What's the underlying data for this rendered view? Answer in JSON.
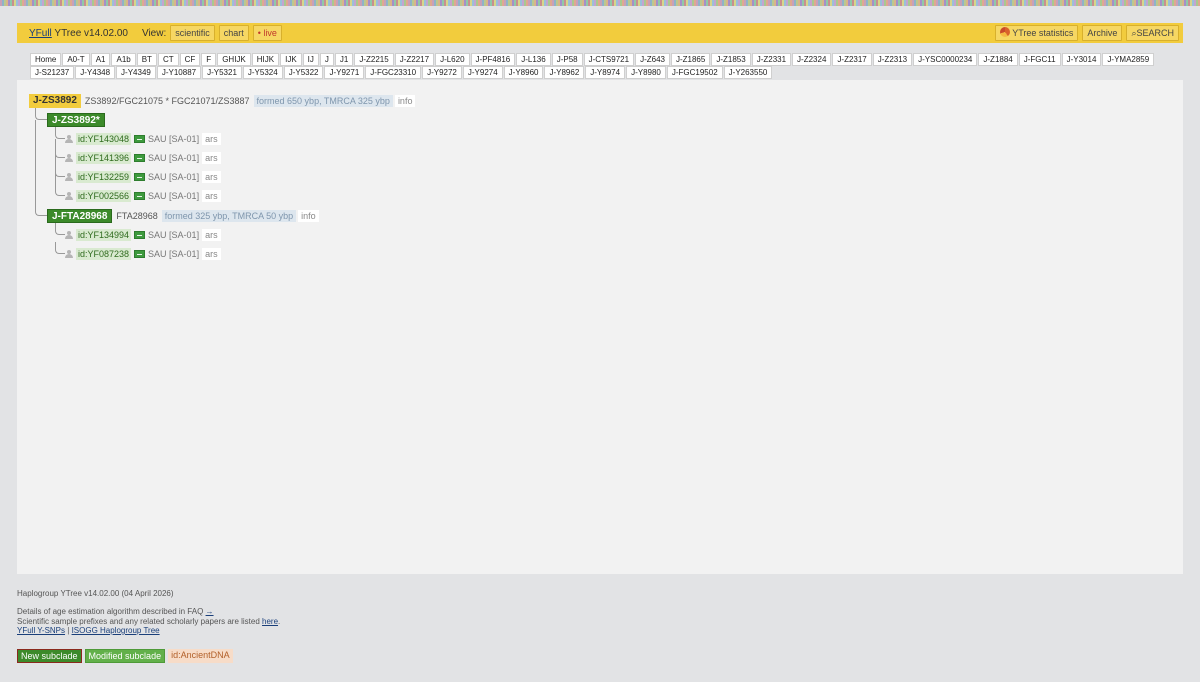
{
  "header": {
    "brand_link": "YFull",
    "brand_rest": " YTree v14.02.00",
    "view_label": "View:",
    "view_buttons": [
      "scientific",
      "chart",
      "• live"
    ],
    "stats_label": "YTree statistics",
    "archive_label": "Archive",
    "search_label": "⌕SEARCH"
  },
  "tabs": [
    "Home",
    "A0-T",
    "A1",
    "A1b",
    "BT",
    "CT",
    "CF",
    "F",
    "GHIJK",
    "HIJK",
    "IJK",
    "IJ",
    "J",
    "J1",
    "J-Z2215",
    "J-Z2217",
    "J-L620",
    "J-PF4816",
    "J-L136",
    "J-P58",
    "J-CTS9721",
    "J-Z643",
    "J-Z1865",
    "J-Z1853",
    "J-Z2331",
    "J-Z2324",
    "J-Z2317",
    "J-Z2313",
    "J-YSC0000234",
    "J-Z1884",
    "J-FGC11",
    "J-Y3014",
    "J-YMA2859",
    "J-S21237",
    "J-Y4348",
    "J-Y4349",
    "J-Y10887",
    "J-Y5321",
    "J-Y5324",
    "J-Y5322",
    "J-Y9271",
    "J-FGC23310",
    "J-Y9272",
    "J-Y9274",
    "J-Y8960",
    "J-Y8962",
    "J-Y8974",
    "J-Y8980",
    "J-FGC19502",
    "J-Y263550"
  ],
  "tree": {
    "root": {
      "name": "J-ZS3892",
      "snps": "ZS3892/FGC21075 * FGC21071/ZS3887",
      "formed": "formed 650 ybp, TMRCA 325 ybp",
      "info": "info"
    },
    "sub1": {
      "name": "J-ZS3892*",
      "samples": [
        {
          "id": "id:YF143048",
          "place": "SAU [SA-01]",
          "tag": "ars"
        },
        {
          "id": "id:YF141396",
          "place": "SAU [SA-01]",
          "tag": "ars"
        },
        {
          "id": "id:YF132259",
          "place": "SAU [SA-01]",
          "tag": "ars"
        },
        {
          "id": "id:YF002566",
          "place": "SAU [SA-01]",
          "tag": "ars"
        }
      ]
    },
    "sub2": {
      "name": "J-FTA28968",
      "snps": "FTA28968",
      "formed": "formed 325 ybp, TMRCA 50 ybp",
      "info": "info",
      "samples": [
        {
          "id": "id:YF134994",
          "place": "SAU [SA-01]",
          "tag": "ars"
        },
        {
          "id": "id:YF087238",
          "place": "SAU [SA-01]",
          "tag": "ars"
        }
      ]
    }
  },
  "footer": {
    "version_line": "Haplogroup YTree v14.02.00 (04 April 2026)",
    "faq_text": "Details of age estimation algorithm described in FAQ ",
    "faq_arrow": "→",
    "prefix_text": "Scientific sample prefixes and any related scholarly papers are listed ",
    "prefix_link": "here",
    "prefix_end": ".",
    "link_snps": "YFull Y-SNPs",
    "separator": " | ",
    "link_isogg": "ISOGG Haplogroup Tree"
  },
  "legend": {
    "new": "New subclade",
    "modified": "Modified subclade",
    "ancient": "id:AncientDNA"
  }
}
